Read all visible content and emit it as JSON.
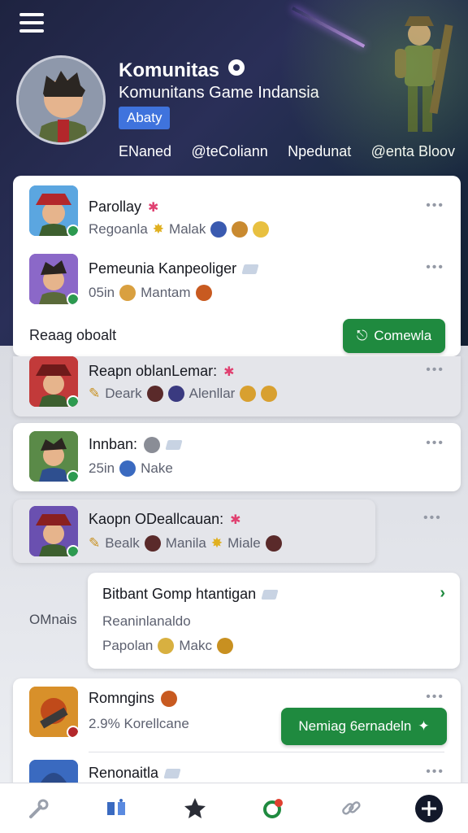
{
  "header": {
    "title": "Komunitas",
    "subtitle": "Komunitans Game Indansia",
    "about_label": "Abaty",
    "tabs": [
      "ENaned",
      "@teColiann",
      "Npedunat",
      "@enta Bloov"
    ]
  },
  "card1": {
    "rows": [
      {
        "title": "Parollay",
        "meta": "Regoanla",
        "meta2": "Malak"
      },
      {
        "title": "Pemeunia Kanpeoliger",
        "meta": "05in",
        "meta2": "Mantam"
      }
    ],
    "section_label": "Reaag oboalt",
    "action_label": "Comewla"
  },
  "card2": {
    "title": "Reapn oblanLemar:",
    "meta": "Deark",
    "meta2": "Alenllar"
  },
  "card3": {
    "title": "Innban:",
    "meta": "25in",
    "meta2": "Nake"
  },
  "card4": {
    "title": "Kaopn ODeallcauan:",
    "meta": "Bealk",
    "meta2": "Manila",
    "meta3": "Miale"
  },
  "card5": {
    "side_label": "OMnais",
    "title": "Bitbant Gomp htantigan",
    "line2": "Reaninlanaldo",
    "meta": "Papolan",
    "meta2": "Makc"
  },
  "card6": {
    "rows": [
      {
        "title": "Romngins",
        "meta": "2.9% Korellcane"
      },
      {
        "title": "Renonaitla"
      }
    ],
    "action_label": "Nemiag 6ernadeln"
  },
  "dots": "•••",
  "colors": {
    "accent_green": "#1f8a3f",
    "accent_blue": "#3f73dd",
    "header_bg": "#1e2340"
  },
  "bottom_nav": [
    "wrench-icon",
    "chat-icon",
    "star-icon",
    "notification-icon",
    "link-icon",
    "add-icon"
  ]
}
